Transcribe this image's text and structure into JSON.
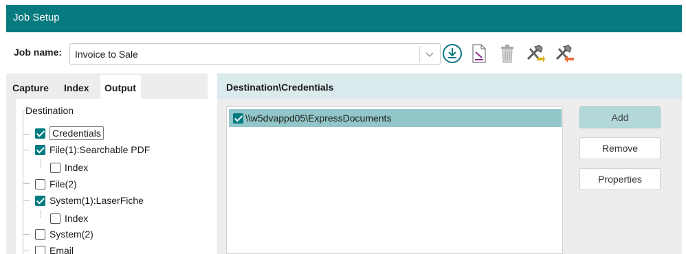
{
  "window": {
    "title": "Job Setup"
  },
  "job": {
    "label": "Job name:",
    "value": "Invoice to Sale"
  },
  "toolbar": {
    "icons": [
      "download-icon",
      "edit-document-icon",
      "trash-icon",
      "tools-forward-icon",
      "tools-back-icon"
    ],
    "colors": {
      "teal": "#077a80",
      "purple": "#8c2b8f",
      "yellow": "#d6b11a",
      "orange": "#e8703a"
    }
  },
  "tabs": [
    "Capture",
    "Index",
    "Output"
  ],
  "active_tab": "Output",
  "tree": {
    "root": "Destination",
    "items": [
      {
        "label": "Credentials",
        "checked": true
      },
      {
        "label": "File(1):Searchable PDF",
        "checked": true
      },
      {
        "label": "Index",
        "checked": false
      },
      {
        "label": "File(2)",
        "checked": false
      },
      {
        "label": "System(1):LaserFiche",
        "checked": true
      },
      {
        "label": "Index",
        "checked": false
      },
      {
        "label": "System(2)",
        "checked": false
      },
      {
        "label": "Email",
        "checked": false
      }
    ]
  },
  "destination": {
    "header": "Destination\\Credentials",
    "items": [
      {
        "label": "\\\\w5dvappd05\\ExpressDocuments",
        "checked": true
      }
    ]
  },
  "buttons": {
    "add": "Add",
    "remove": "Remove",
    "properties": "Properties"
  },
  "colors": {
    "accent": "#077a80",
    "selection": "#93c6c8",
    "header_bg": "#dbeaec"
  }
}
